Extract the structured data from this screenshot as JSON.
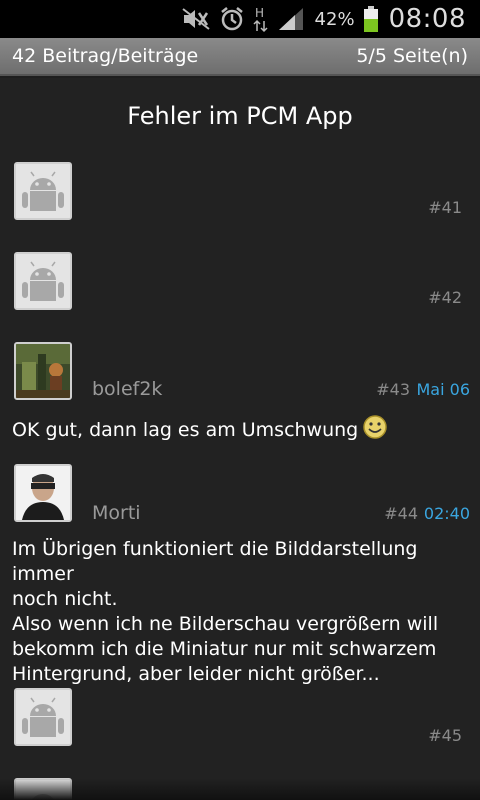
{
  "status_bar": {
    "icons": [
      "mute-icon",
      "alarm-icon",
      "hsdpa-icon",
      "signal-icon",
      "battery-icon"
    ],
    "network_type": "H",
    "battery_percent": "42%",
    "time": "08:08"
  },
  "header": {
    "post_count": "42 Beitrag/Beiträge",
    "page_info": "5/5 Seite(n)"
  },
  "thread": {
    "title": "Fehler im PCM App"
  },
  "posts": [
    {
      "number": "#41",
      "author": "",
      "time": "",
      "text": "",
      "avatar": "default-android-avatar"
    },
    {
      "number": "#42",
      "author": "",
      "time": "",
      "text": "",
      "avatar": "default-android-avatar"
    },
    {
      "number": "#43",
      "author": "bolef2k",
      "time": "Mai 06",
      "text": "OK gut, dann lag es am Umschwung",
      "avatar": "user-photo-avatar",
      "emoticon": "smiley-icon"
    },
    {
      "number": "#44",
      "author": "Morti",
      "time": "02:40",
      "text_lines": [
        "Im Übrigen funktioniert die Bilddarstellung immer",
        "noch nicht.",
        "Also wenn ich ne Bilderschau vergrößern will",
        "bekomm ich die Miniatur nur mit schwarzem",
        "Hintergrund, aber leider nicht größer..."
      ],
      "avatar": "user-photo-avatar"
    },
    {
      "number": "#45",
      "author": "",
      "time": "",
      "text": "",
      "avatar": "default-android-avatar"
    }
  ],
  "colors": {
    "background": "#222222",
    "header_bar": "#7a7a7a",
    "time_accent": "#3aa6e0",
    "muted_text": "#8a8a8a"
  }
}
